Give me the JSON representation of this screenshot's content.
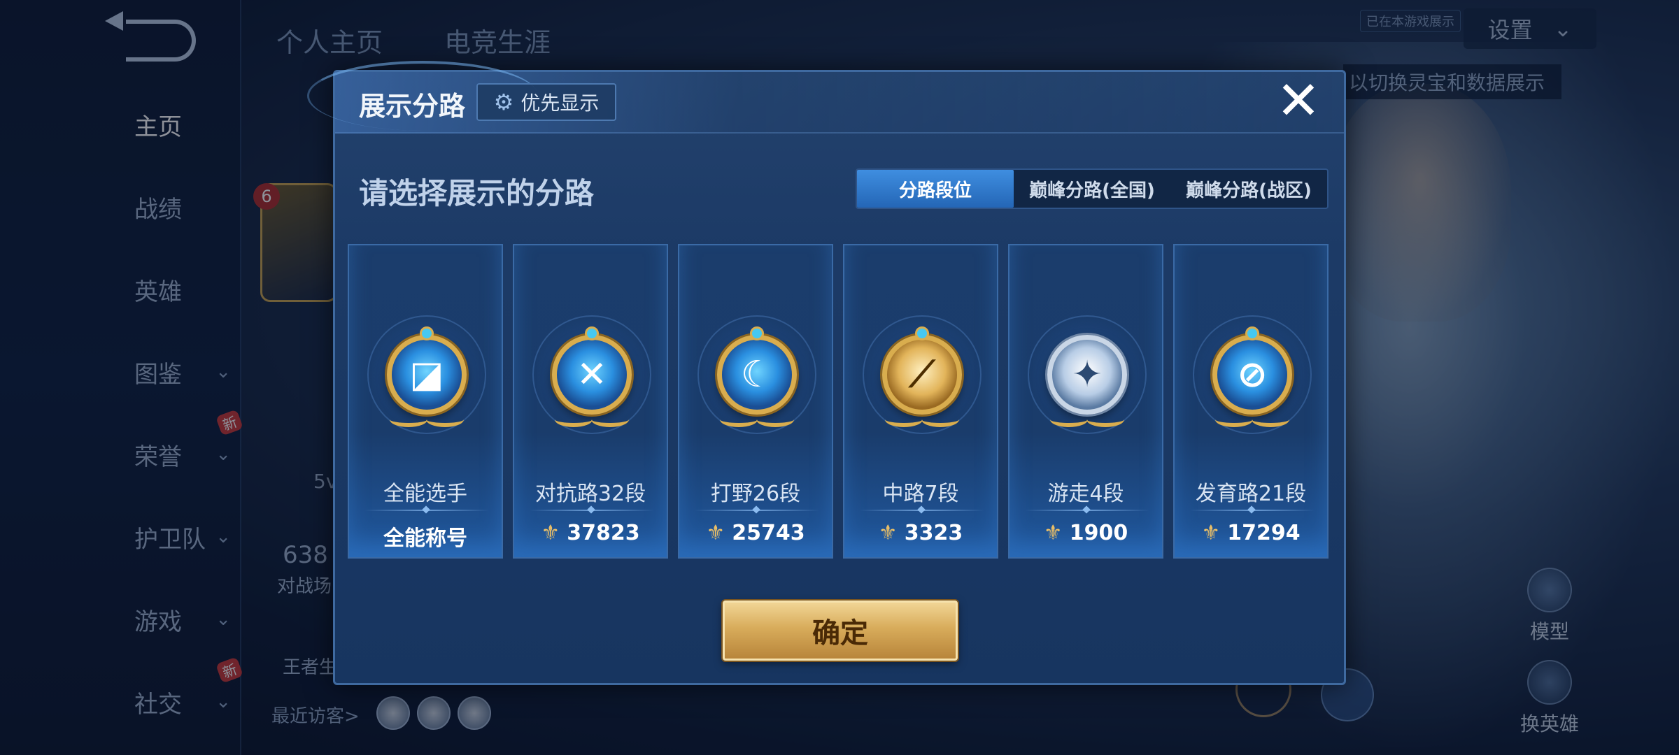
{
  "background": {
    "top_tabs": [
      "个人主页",
      "电竞生涯"
    ],
    "settings_label": "设置",
    "top_badge": "已在本游戏展示",
    "top_hint": "以切换灵宝和数据展示",
    "avatar_level": "6",
    "left_stat_1": "5v",
    "left_stat_2": "638",
    "left_stat_2_caption": "对战场",
    "left_stat_3": "王者生",
    "recent_visitors_label": "最近访客>",
    "right_actions": [
      "模型",
      "换英雄"
    ]
  },
  "sidebar": {
    "items": [
      {
        "label": "主页",
        "chevron": false,
        "new": false,
        "active": true
      },
      {
        "label": "战绩",
        "chevron": false,
        "new": false,
        "active": false
      },
      {
        "label": "英雄",
        "chevron": false,
        "new": false,
        "active": false
      },
      {
        "label": "图鉴",
        "chevron": true,
        "new": false,
        "active": false
      },
      {
        "label": "荣誉",
        "chevron": true,
        "new": true,
        "active": false
      },
      {
        "label": "护卫队",
        "chevron": true,
        "new": false,
        "active": false
      },
      {
        "label": "游戏",
        "chevron": true,
        "new": false,
        "active": false
      },
      {
        "label": "社交",
        "chevron": true,
        "new": true,
        "active": false
      }
    ],
    "new_badge": "新"
  },
  "modal": {
    "title": "展示分路",
    "priority_button": "优先显示",
    "close_icon": "✕",
    "subtitle": "请选择展示的分路",
    "tabs": [
      {
        "label": "分路段位",
        "active": true
      },
      {
        "label": "巅峰分路(全国)",
        "active": false
      },
      {
        "label": "巅峰分路(战区)",
        "active": false
      }
    ],
    "cards": [
      {
        "name": "全能选手",
        "value": "全能称号",
        "peak_icon": false,
        "emblem": "all-round-emblem-icon",
        "glyph": "◪",
        "style": "blue"
      },
      {
        "name": "对抗路32段",
        "value": "37823",
        "peak_icon": true,
        "emblem": "clash-lane-emblem-icon",
        "glyph": "✕",
        "style": "blue"
      },
      {
        "name": "打野26段",
        "value": "25743",
        "peak_icon": true,
        "emblem": "jungle-emblem-icon",
        "glyph": "☾",
        "style": "blue"
      },
      {
        "name": "中路7段",
        "value": "3323",
        "peak_icon": true,
        "emblem": "mid-lane-emblem-icon",
        "glyph": "⟋",
        "style": "gold"
      },
      {
        "name": "游走4段",
        "value": "1900",
        "peak_icon": true,
        "emblem": "roam-emblem-icon",
        "glyph": "✦",
        "style": "silver"
      },
      {
        "name": "发育路21段",
        "value": "17294",
        "peak_icon": true,
        "emblem": "farm-lane-emblem-icon",
        "glyph": "⊘",
        "style": "blue"
      }
    ],
    "confirm_button": "确定"
  },
  "colors": {
    "accent_blue": "#2f7fd6",
    "confirm_gold": "#d8ac5b",
    "modal_bg": "#1c3a66"
  }
}
